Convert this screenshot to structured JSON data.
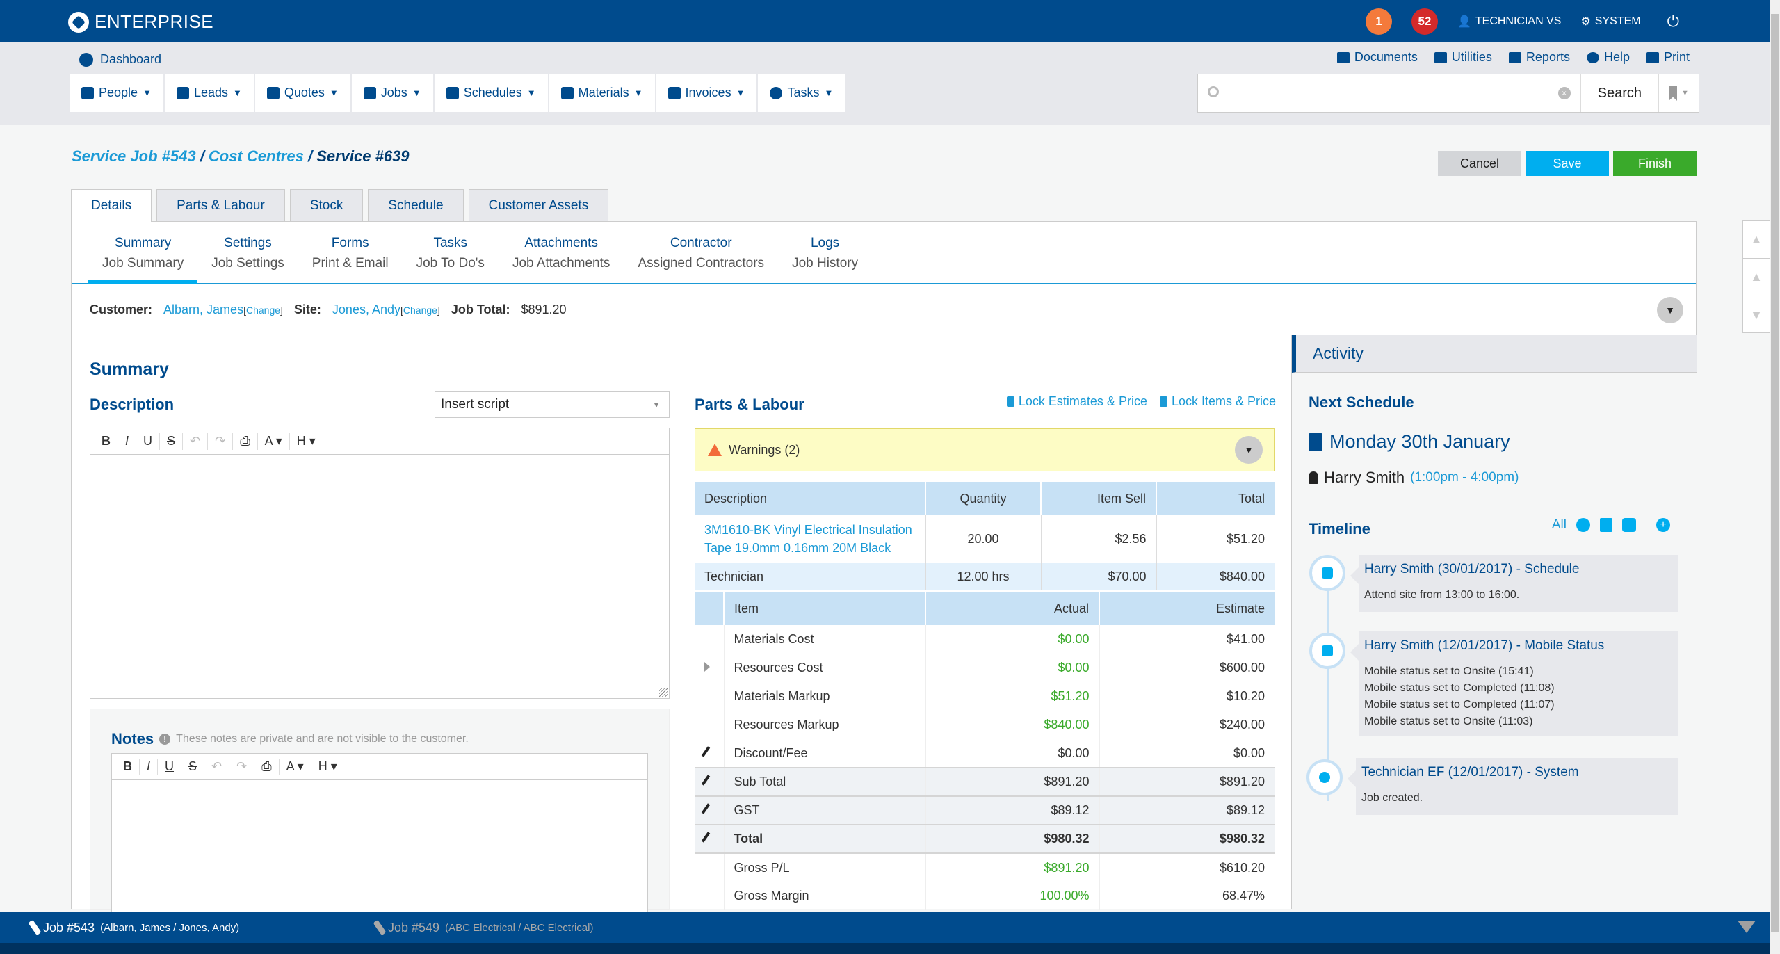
{
  "app": {
    "title": "ENTERPRISE"
  },
  "topbar": {
    "notif_orange": "1",
    "notif_red": "52",
    "user": "TECHNICIAN VS",
    "system": "SYSTEM"
  },
  "dashboard": "Dashboard",
  "nav": [
    {
      "label": "People",
      "icon": "people-icon"
    },
    {
      "label": "Leads",
      "icon": "phone-icon"
    },
    {
      "label": "Quotes",
      "icon": "document-icon"
    },
    {
      "label": "Jobs",
      "icon": "wrench-icon"
    },
    {
      "label": "Schedules",
      "icon": "calendar-icon"
    },
    {
      "label": "Materials",
      "icon": "box-icon"
    },
    {
      "label": "Invoices",
      "icon": "coins-icon"
    },
    {
      "label": "Tasks",
      "icon": "check-circle-icon"
    }
  ],
  "toplinks": [
    "Documents",
    "Utilities",
    "Reports",
    "Help",
    "Print"
  ],
  "search": {
    "value": "",
    "placeholder": "",
    "button": "Search"
  },
  "breadcrumb": {
    "part1": "Service Job #543",
    "part2": "Cost Centres",
    "current": "Service #639",
    "sep": " / "
  },
  "actions": {
    "cancel": "Cancel",
    "save": "Save",
    "finish": "Finish"
  },
  "tabs": [
    "Details",
    "Parts & Labour",
    "Stock",
    "Schedule",
    "Customer Assets"
  ],
  "subnav": [
    {
      "t1": "Summary",
      "t2": "Job Summary"
    },
    {
      "t1": "Settings",
      "t2": "Job Settings"
    },
    {
      "t1": "Forms",
      "t2": "Print & Email"
    },
    {
      "t1": "Tasks",
      "t2": "Job To Do's"
    },
    {
      "t1": "Attachments",
      "t2": "Job Attachments"
    },
    {
      "t1": "Contractor",
      "t2": "Assigned Contractors"
    },
    {
      "t1": "Logs",
      "t2": "Job History"
    }
  ],
  "info": {
    "customer_label": "Customer:",
    "customer": "Albarn, James",
    "change": "Change",
    "site_label": "Site:",
    "site": "Jones, Andy",
    "total_label": "Job Total:",
    "total": "$891.20"
  },
  "summary": {
    "title": "Summary",
    "description": "Description",
    "insert_script": "Insert script",
    "notes": "Notes",
    "notes_hint": "These notes are private and are not visible to the customer."
  },
  "editor_tools": [
    "B",
    "I",
    "U",
    "S",
    "↶",
    "↷",
    "⎙",
    "A ▾",
    "H ▾"
  ],
  "parts": {
    "title": "Parts & Labour",
    "lock_estimates": "Lock Estimates & Price",
    "lock_items": "Lock Items & Price",
    "warnings": "Warnings (2)",
    "headers": [
      "Description",
      "Quantity",
      "Item Sell",
      "Total"
    ],
    "rows": [
      {
        "desc": "3M1610-BK Vinyl Electrical Insulation Tape 19.0mm 0.16mm 20M Black",
        "qty": "20.00",
        "sell": "$2.56",
        "total": "$51.20"
      },
      {
        "desc": "Technician",
        "qty": "12.00 hrs",
        "sell": "$70.00",
        "total": "$840.00"
      }
    ]
  },
  "costs": {
    "headers": [
      "Item",
      "Actual",
      "Estimate"
    ],
    "rows": [
      {
        "item": "Materials Cost",
        "actual": "$0.00",
        "estimate": "$41.00"
      },
      {
        "item": "Resources Cost",
        "actual": "$0.00",
        "estimate": "$600.00"
      },
      {
        "item": "Materials Markup",
        "actual": "$51.20",
        "estimate": "$10.20"
      },
      {
        "item": "Resources Markup",
        "actual": "$840.00",
        "estimate": "$240.00"
      },
      {
        "item": "Discount/Fee",
        "actual": "$0.00",
        "estimate": "$0.00"
      },
      {
        "item": "Sub Total",
        "actual": "$891.20",
        "estimate": "$891.20"
      },
      {
        "item": "GST",
        "actual": "$89.12",
        "estimate": "$89.12"
      },
      {
        "item": "Total",
        "actual": "$980.32",
        "estimate": "$980.32"
      },
      {
        "item": "Gross P/L",
        "actual": "$891.20",
        "estimate": "$610.20"
      },
      {
        "item": "Gross Margin",
        "actual": "100.00%",
        "estimate": "68.47%"
      }
    ]
  },
  "activity": {
    "title": "Activity",
    "next_schedule": "Next Schedule",
    "date": "Monday 30th January",
    "person": "Harry Smith",
    "time": "(1:00pm - 4:00pm)",
    "timeline": "Timeline",
    "filter_all": "All",
    "events": [
      {
        "title": "Harry Smith (30/01/2017) - Schedule",
        "lines": [
          "Attend site from 13:00 to 16:00."
        ]
      },
      {
        "title": "Harry Smith (12/01/2017) - Mobile Status",
        "lines": [
          "Mobile status set to Onsite (15:41)",
          "Mobile status set to Completed (11:08)",
          "Mobile status set to Completed (11:07)",
          "Mobile status set to Onsite (11:03)"
        ]
      },
      {
        "title": "Technician EF (12/01/2017) - System",
        "lines": [
          "Job created."
        ]
      }
    ]
  },
  "bottom": {
    "job1": "Job #543",
    "job1_detail": "(Albarn, James / Jones, Andy)",
    "job2": "Job #549",
    "job2_detail": "(ABC Electrical / ABC Electrical)"
  },
  "colors": {
    "brand": "#004b8d",
    "accent": "#00aeef",
    "success": "#3aaa2b",
    "warning_bg": "#fdfcc5"
  }
}
